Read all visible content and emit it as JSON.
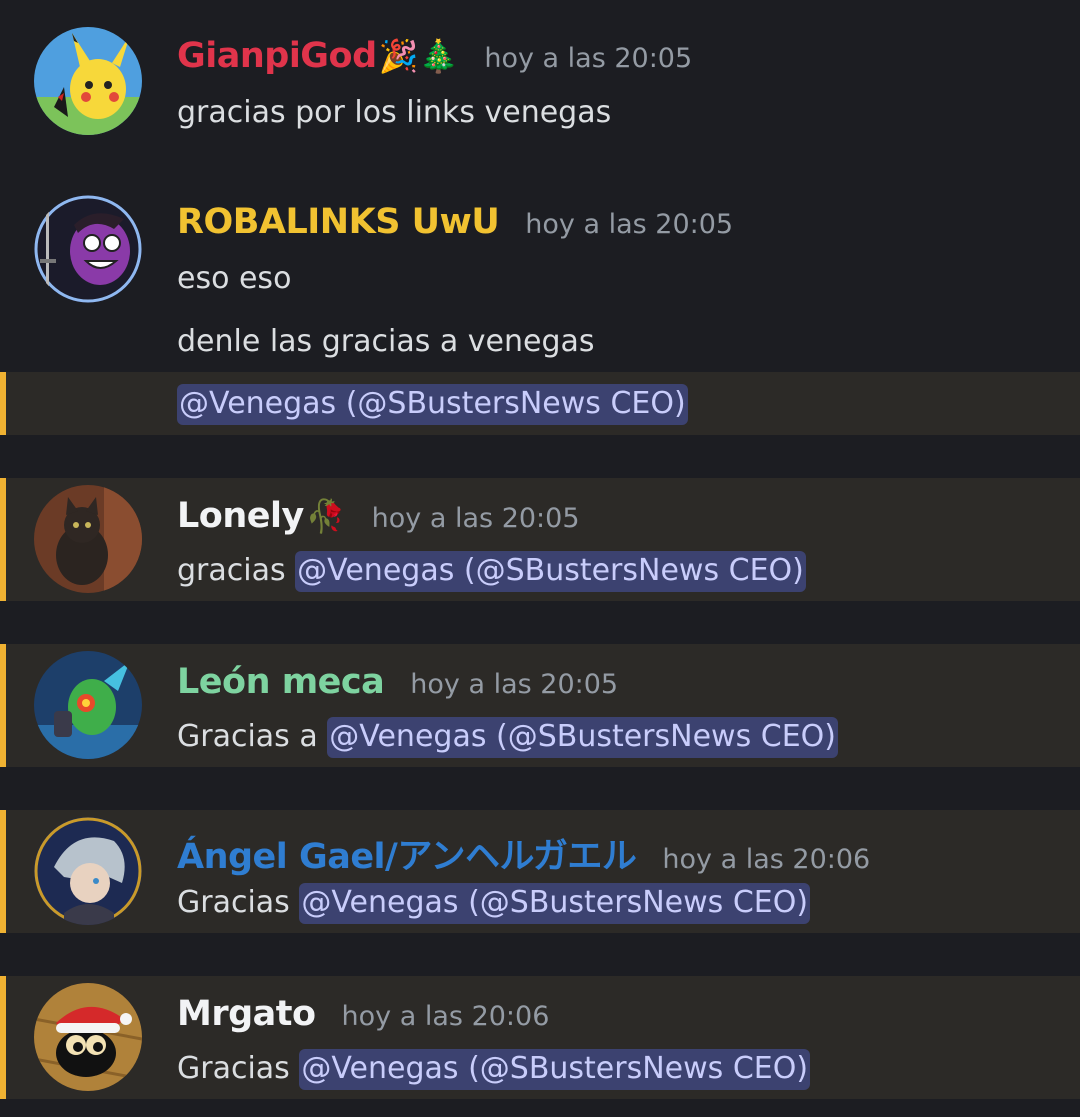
{
  "colors": {
    "background": "#1c1d22",
    "mention_highlight": "#2c2a27",
    "mention_bar": "#f0b232",
    "mention_pill_bg": "#3c4270",
    "mention_pill_text": "#c9cdfb",
    "timestamp": "#949ba4",
    "body_text": "#dbdee1"
  },
  "mention_text": "@Venegas  (@SBustersNews CEO)",
  "messages": [
    {
      "username": "GianpiGod",
      "username_color": "#e0344b",
      "emojis": "🎉🎄",
      "timestamp": "hoy a las 20:05",
      "avatar_icon": "pikachu-avatar-icon",
      "lines": [
        "gracias por los links venegas"
      ]
    },
    {
      "username": "ROBALINKS UwU",
      "username_color": "#f1c231",
      "emojis": "",
      "timestamp": "hoy a las 20:05",
      "avatar_icon": "purple-cartoon-avatar-icon",
      "lines": [
        "eso eso",
        "denle las gracias a venegas"
      ]
    },
    {
      "username": "Lonely",
      "username_color": "#f2f3f5",
      "emojis": "🥀",
      "timestamp": "hoy a las 20:05",
      "avatar_icon": "cat-avatar-icon",
      "prefix": "gracias"
    },
    {
      "username": "León meca",
      "username_color": "#7ed3a0",
      "emojis": "",
      "timestamp": "hoy a las 20:05",
      "avatar_icon": "green-robot-avatar-icon",
      "prefix": "Gracias a"
    },
    {
      "username": "Ángel Gael/アンヘルガエル",
      "username_color": "#2f7dd1",
      "emojis": "",
      "timestamp": "hoy a las 20:06",
      "avatar_icon": "anime-character-avatar-icon",
      "prefix": "Gracias"
    },
    {
      "username": "Mrgato",
      "username_color": "#f2f3f5",
      "emojis": "",
      "timestamp": "hoy a las 20:06",
      "avatar_icon": "santa-hat-cat-avatar-icon",
      "prefix": "Gracias"
    }
  ]
}
